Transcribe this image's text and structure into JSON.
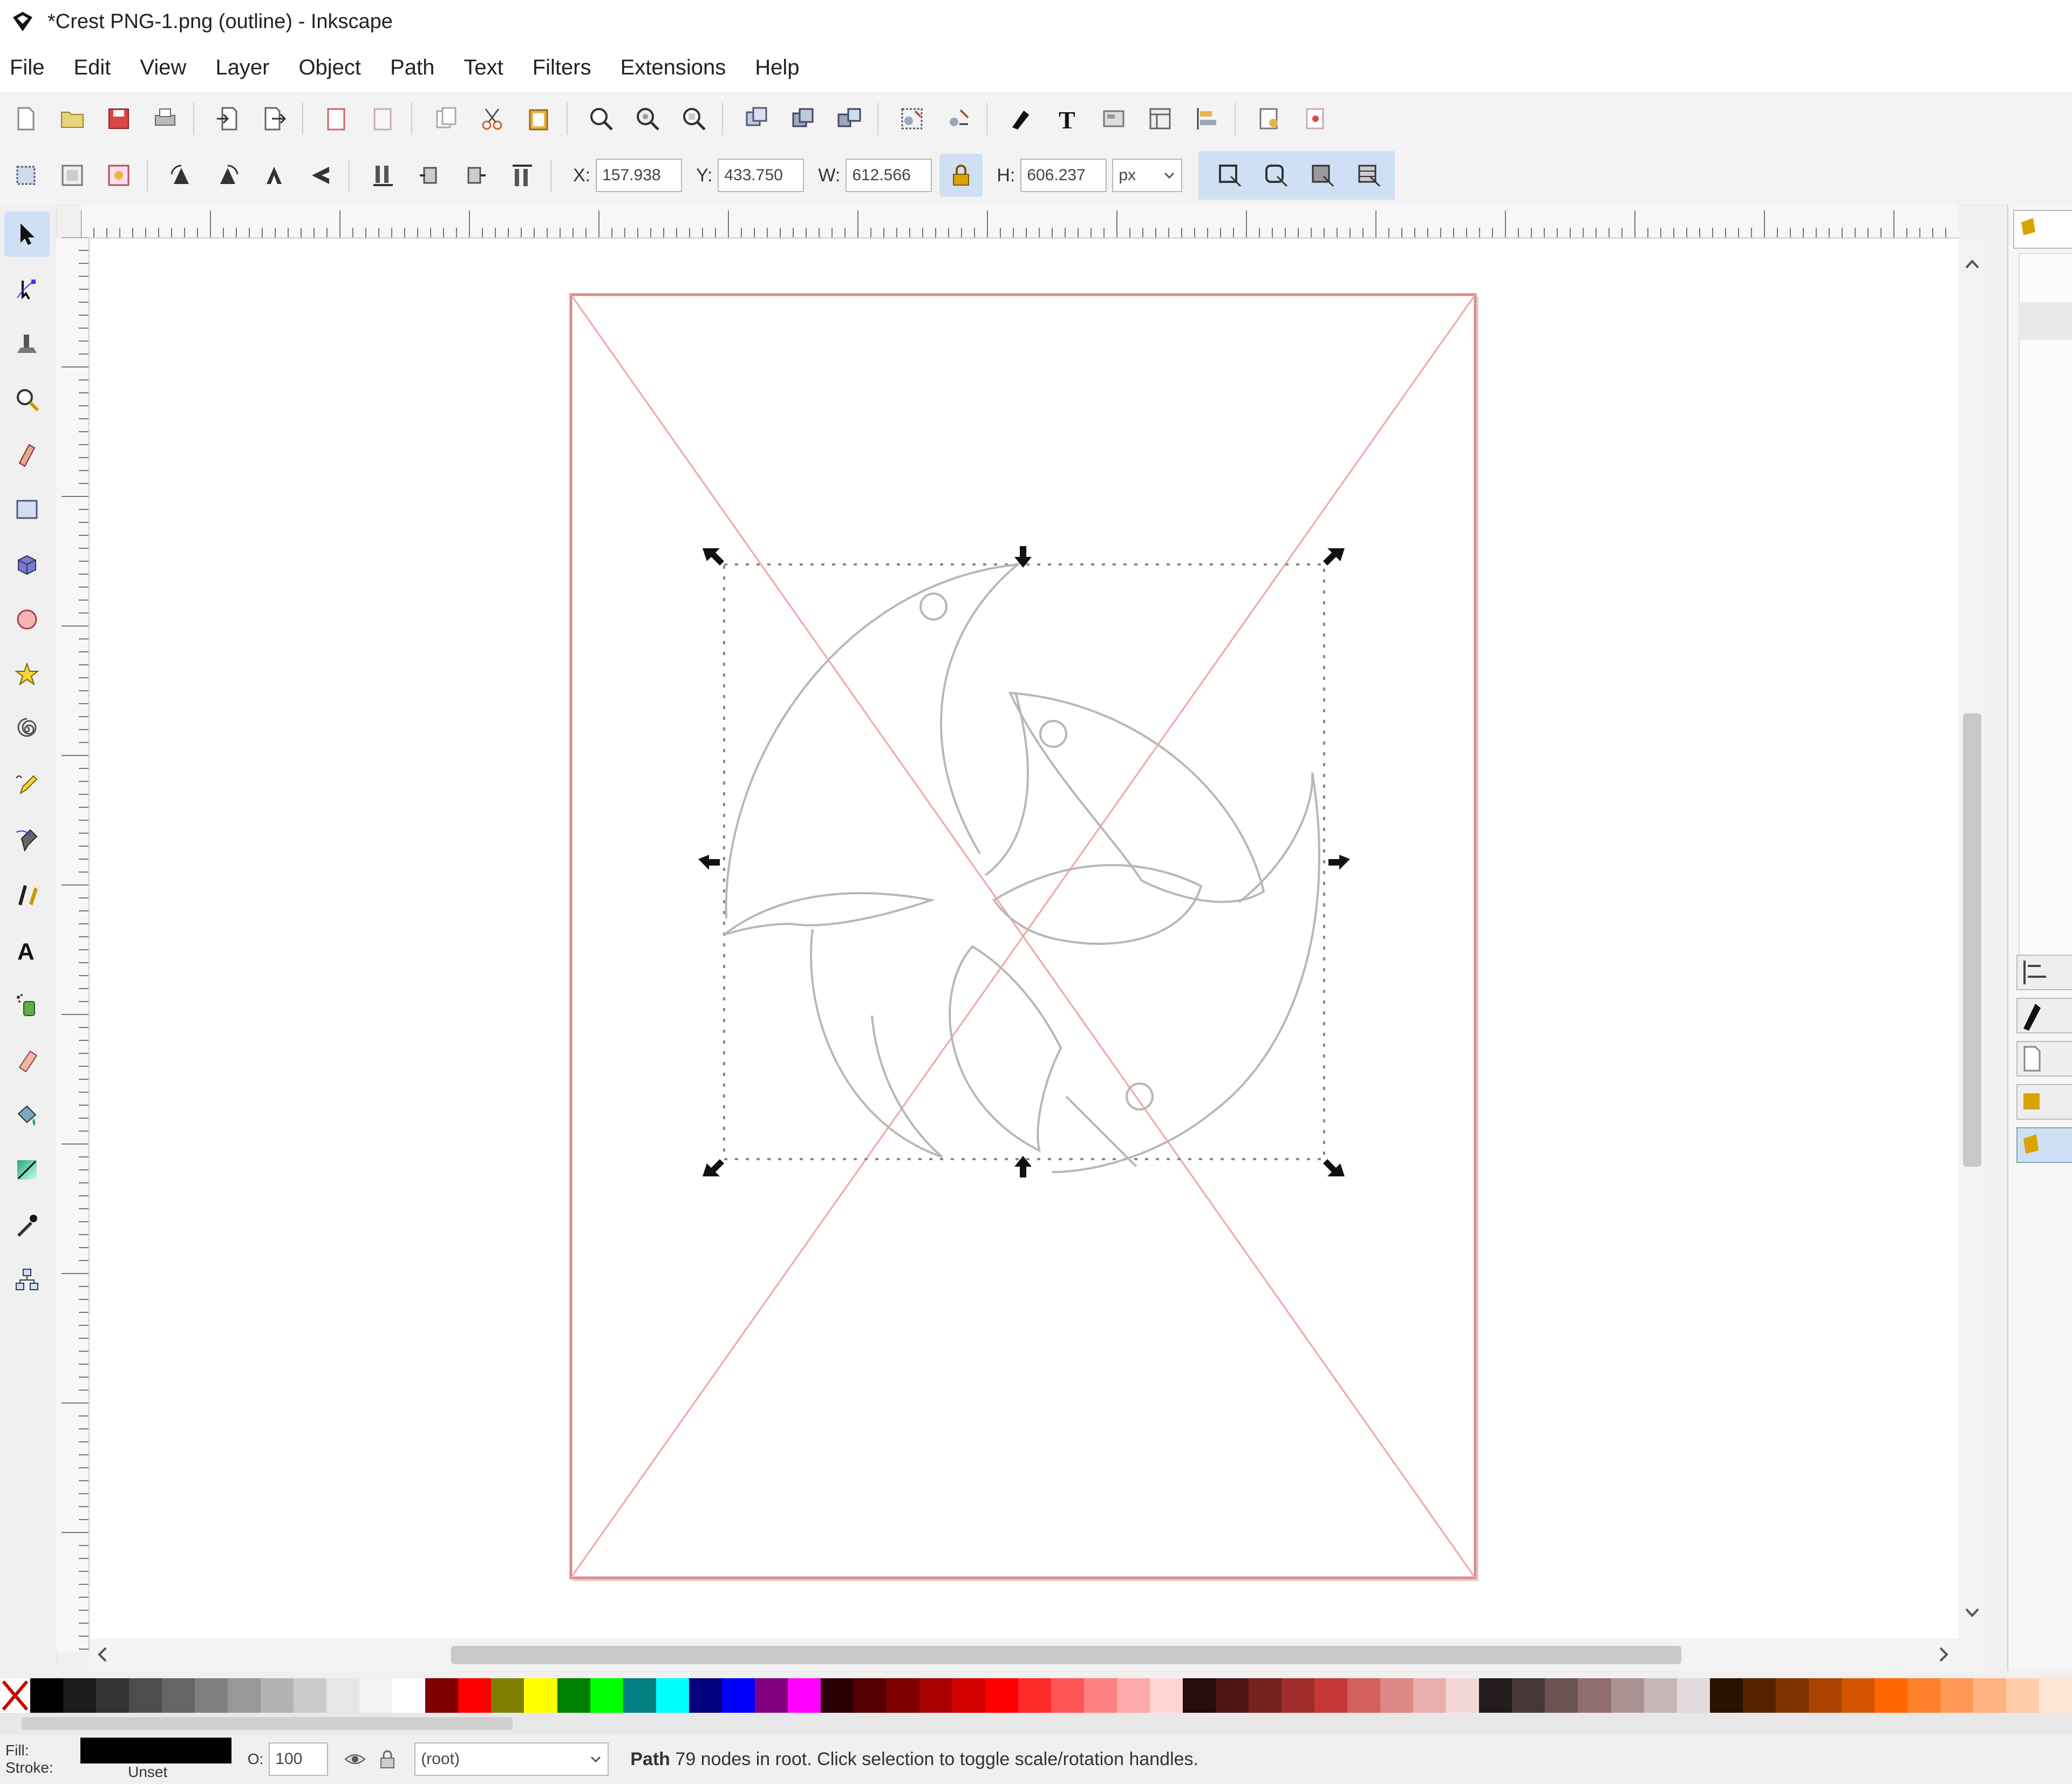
{
  "window": {
    "title": "*Crest PNG-1.png (outline) - Inkscape"
  },
  "menu": {
    "items": [
      "File",
      "Edit",
      "View",
      "Layer",
      "Object",
      "Path",
      "Text",
      "Filters",
      "Extensions",
      "Help"
    ]
  },
  "controls": {
    "x_label": "X:",
    "x_value": "157.938",
    "y_label": "Y:",
    "y_value": "433.750",
    "w_label": "W:",
    "w_value": "612.566",
    "h_label": "H:",
    "h_value": "606.237",
    "unit": "px"
  },
  "colors": {
    "page_border": "#d98a8a",
    "guide": "#f2a5a5",
    "path_outline": "#b7b7b7",
    "accent_toggle": "#cfe0f5"
  },
  "tools": [
    "selector-tool",
    "node-tool",
    "tweak-tool",
    "zoom-tool",
    "measure-tool",
    "rectangle-tool",
    "3dbox-tool",
    "ellipse-tool",
    "star-tool",
    "spiral-tool",
    "pencil-tool",
    "pen-tool",
    "calligraphy-tool",
    "text-tool",
    "spray-tool",
    "eraser-tool",
    "paint-bucket-tool",
    "gradient-tool",
    "dropper-tool",
    "connector-tool"
  ],
  "palette": [
    "#000000",
    "#1c1c1c",
    "#333333",
    "#4d4d4d",
    "#666666",
    "#808080",
    "#999999",
    "#b3b3b3",
    "#cccccc",
    "#e6e6e6",
    "#f2f2f2",
    "#ffffff",
    "#800000",
    "#ff0000",
    "#808000",
    "#ffff00",
    "#008000",
    "#00ff00",
    "#008080",
    "#00ffff",
    "#000080",
    "#0000ff",
    "#800080",
    "#ff00ff",
    "#2b0000",
    "#550000",
    "#800000",
    "#aa0000",
    "#d40000",
    "#ff0000",
    "#ff2a2a",
    "#ff5555",
    "#ff8080",
    "#ffaaaa",
    "#ffd5d5",
    "#280b0b",
    "#501616",
    "#782121",
    "#a02c2c",
    "#c83737",
    "#d35f5f",
    "#de8787",
    "#e9afaf",
    "#f4d7d7",
    "#241c1c",
    "#483737",
    "#6c5353",
    "#916f6f",
    "#ac9393",
    "#c8b7b7",
    "#e3dbdb",
    "#2b1100",
    "#552200",
    "#803300",
    "#aa4400",
    "#d45500",
    "#ff6600",
    "#ff7f2a",
    "#ff9955",
    "#ffb380",
    "#ffccaa",
    "#ffe6d5"
  ],
  "status": {
    "fill_label": "Fill:",
    "stroke_label": "Stroke:",
    "stroke_value": "Unset",
    "opacity_label": "O:",
    "opacity_value": "100",
    "layer": "(root)",
    "message_bold": "Path",
    "message": "79 nodes in root. Click selection to toggle scale/rotation handles."
  }
}
